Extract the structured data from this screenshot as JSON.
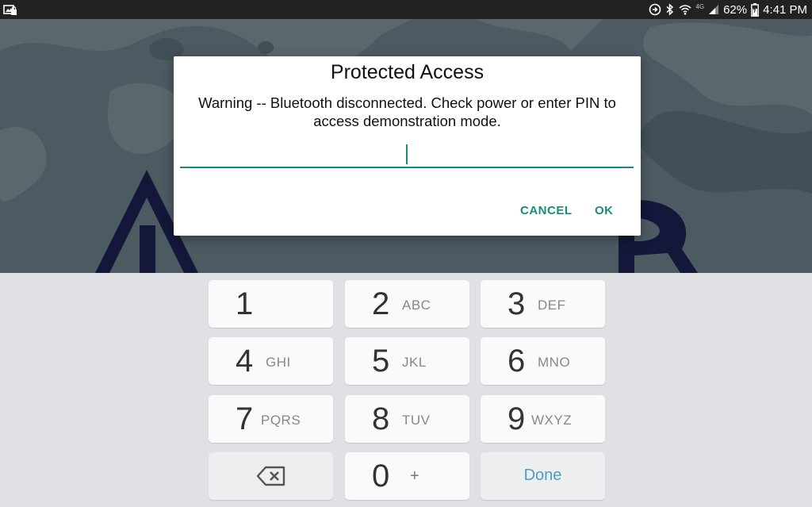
{
  "status_bar": {
    "left_icons": [
      "photo-lock-icon"
    ],
    "right_icons": [
      "sync-icon",
      "bluetooth-icon",
      "wifi-icon",
      "lte-icon",
      "signal-icon",
      "battery-icon"
    ],
    "network_label": "4G",
    "battery_percent": "62%",
    "time": "4:41 PM"
  },
  "background": {
    "brand_text": "LEAZZERS",
    "accent_color": "#1c2150",
    "bg_color": "#6a7f88"
  },
  "dialog": {
    "title": "Protected Access",
    "message": "Warning -- Bluetooth disconnected. Check power or enter PIN to access demonstration mode.",
    "pin_value": "",
    "cancel_label": "CANCEL",
    "ok_label": "OK",
    "accent_color": "#1a8a7f"
  },
  "keypad": {
    "keys": [
      {
        "digit": "1",
        "letters": ""
      },
      {
        "digit": "2",
        "letters": "ABC"
      },
      {
        "digit": "3",
        "letters": "DEF"
      },
      {
        "digit": "4",
        "letters": "GHI"
      },
      {
        "digit": "5",
        "letters": "JKL"
      },
      {
        "digit": "6",
        "letters": "MNO"
      },
      {
        "digit": "7",
        "letters": "PQRS"
      },
      {
        "digit": "8",
        "letters": "TUV"
      },
      {
        "digit": "9",
        "letters": "WXYZ"
      },
      {
        "digit": "0",
        "letters": "+"
      }
    ],
    "backspace_icon": "backspace-icon",
    "done_label": "Done"
  }
}
